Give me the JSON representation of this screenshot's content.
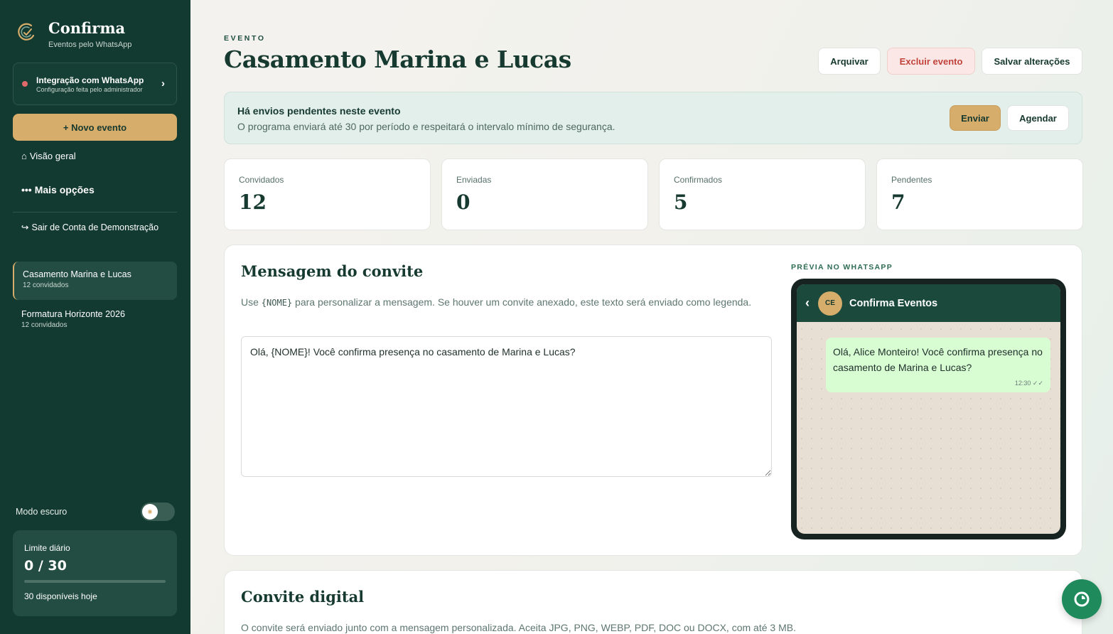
{
  "brand": {
    "name": "Confirma",
    "tagline": "Eventos pelo WhatsApp"
  },
  "sidebar": {
    "whatsapp": {
      "title": "Integração com WhatsApp",
      "subtitle": "Configuração feita pelo administrador",
      "status_color": "#e06a6a"
    },
    "new_event_label": "+ Novo evento",
    "nav": {
      "overview": "Visão geral",
      "more": "Mais opções",
      "logout": "Sair de Conta de Demonstração"
    },
    "events": [
      {
        "title": "Casamento Marina e Lucas",
        "subtitle": "12 convidados",
        "active": true
      },
      {
        "title": "Formatura Horizonte 2026",
        "subtitle": "12 convidados",
        "active": false
      }
    ],
    "dark_mode_label": "Modo escuro",
    "dark_mode_on": false,
    "limit": {
      "label": "Limite diário",
      "value": "0 / 30",
      "used": 0,
      "max": 30,
      "available": "30 disponíveis hoje"
    }
  },
  "header": {
    "eyebrow": "EVENTO",
    "title": "Casamento Marina e Lucas",
    "archive_label": "Arquivar",
    "delete_label": "Excluir evento",
    "save_label": "Salvar alterações"
  },
  "alert": {
    "title": "Há envios pendentes neste evento",
    "text": "O programa enviará até 30 por período e respeitará o intervalo mínimo de segurança.",
    "send_label": "Enviar",
    "schedule_label": "Agendar"
  },
  "stats": [
    {
      "label": "Convidados",
      "value": "12"
    },
    {
      "label": "Enviadas",
      "value": "0"
    },
    {
      "label": "Confirmados",
      "value": "5"
    },
    {
      "label": "Pendentes",
      "value": "7"
    }
  ],
  "message": {
    "title": "Mensagem do convite",
    "help_before": "Use ",
    "help_token": "{NOME}",
    "help_after": " para personalizar a mensagem. Se houver um convite anexado, este texto será enviado como legenda.",
    "value": "Olá, {NOME}! Você confirma presença no casamento de Marina e Lucas?"
  },
  "preview": {
    "label": "PRÉVIA NO WHATSAPP",
    "avatar_initials": "CE",
    "contact_name": "Confirma Eventos",
    "bubble_text": "Olá, Alice Monteiro! Você confirma presença no casamento de Marina e Lucas?",
    "bubble_time": "12:30 ✓✓"
  },
  "invite": {
    "title": "Convite digital",
    "text": "O convite será enviado junto com a mensagem personalizada. Aceita JPG, PNG, WEBP, PDF, DOC ou DOCX, com até 3 MB."
  },
  "colors": {
    "sidebar_bg": "#133a30",
    "accent_gold": "#d7ad6b",
    "danger": "#c2423c",
    "whatsapp_green": "#1f8a5b"
  },
  "icons": {
    "logo": "confirma-logo-icon",
    "home": "home-icon",
    "more": "more-dots-icon",
    "logout": "logout-arrow-icon",
    "chevron": "chevron-right-icon",
    "sun": "sun-icon",
    "back": "back-arrow-icon",
    "fab": "chat-icon"
  }
}
